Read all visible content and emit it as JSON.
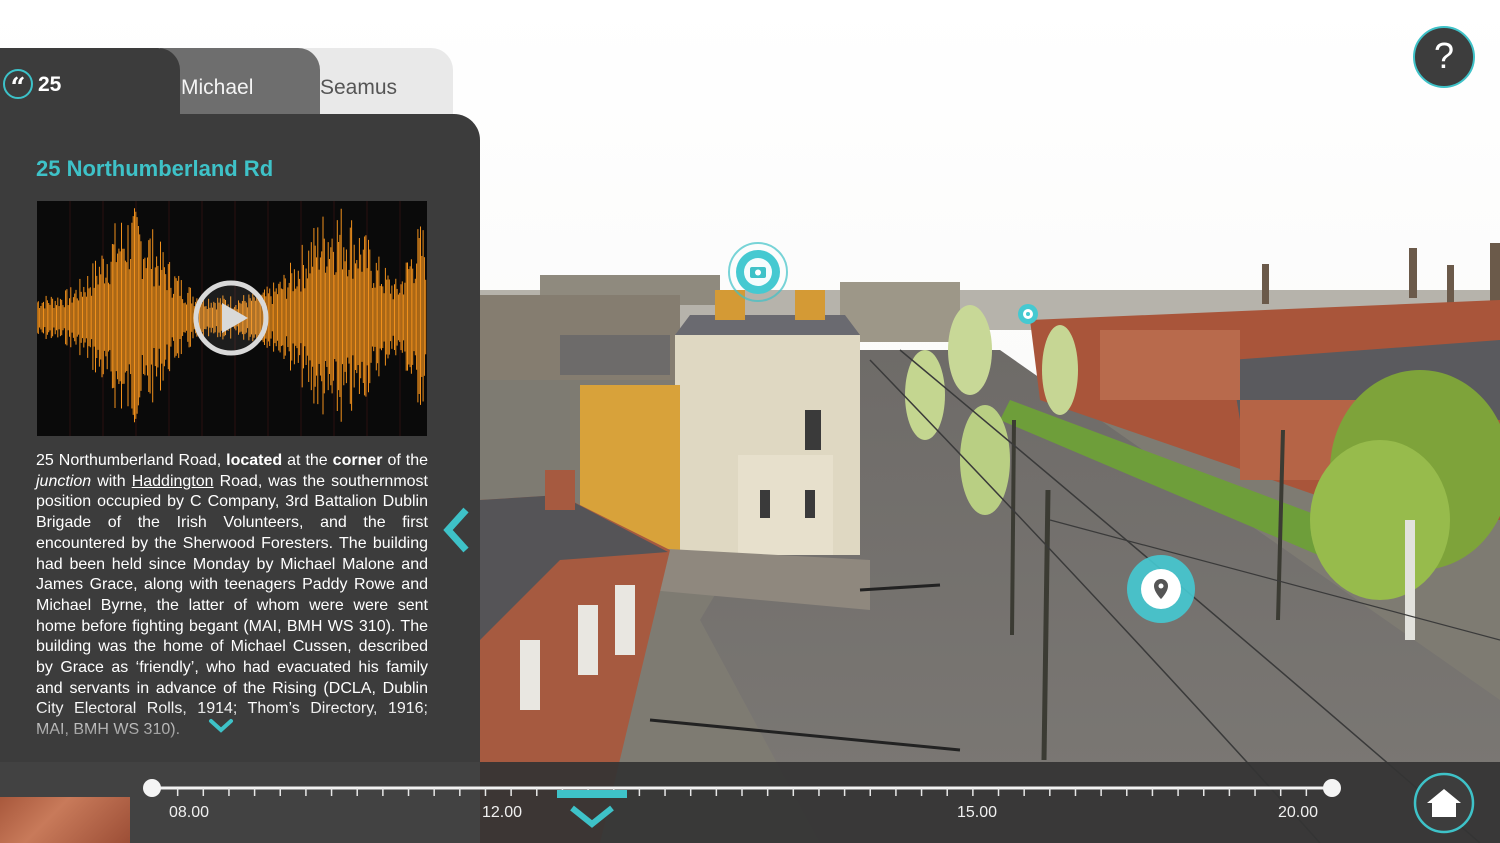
{
  "colors": {
    "accent": "#3ec2c8",
    "panel": "#3c3c3c",
    "waveform": "#f0901c"
  },
  "tabs": [
    {
      "label": "25",
      "icon": "quote-icon"
    },
    {
      "label": "Michael"
    },
    {
      "label": "Seamus"
    }
  ],
  "panel": {
    "title": "25 Northumberland Rd",
    "audio": {
      "icon": "play-icon"
    },
    "text": {
      "p1_a": "25 Northumberland Road, ",
      "p1_b": "located",
      "p1_c": " at the ",
      "p1_d": "corner",
      "p1_e": " of the ",
      "p1_f": "junction",
      "p1_g": " with ",
      "p1_h": "Haddington",
      "p1_i": " Road, was the southernmost position occupied by C Company, 3rd Battalion Dublin Brigade of the Irish Volunteers, and the first encountered by the Sherwood Foresters. The building had been held since Monday by Michael Malone and James Grace, along with teenagers Paddy Rowe and Michael Byrne, the latter of whom were were sent home before fighting begant (MAI, BMH WS 310). The building was the home of Michael Cussen, described by Grace as ‘friendly’, who had evacuated his family and servants in advance of the Rising (DCLA, Dublin City Electoral Rolls, 1914; Thom’s Directory, 1916; MAI, BMH WS 310)."
    }
  },
  "help": {
    "label": "?"
  },
  "timeline": {
    "labels": [
      "08.00",
      "12.00",
      "15.00",
      "20.00"
    ],
    "current_position_fraction": 0.5
  },
  "markers": [
    {
      "icon": "camera-icon"
    },
    {
      "icon": "location-pin-icon"
    },
    {
      "icon": "small-point-icon"
    }
  ]
}
